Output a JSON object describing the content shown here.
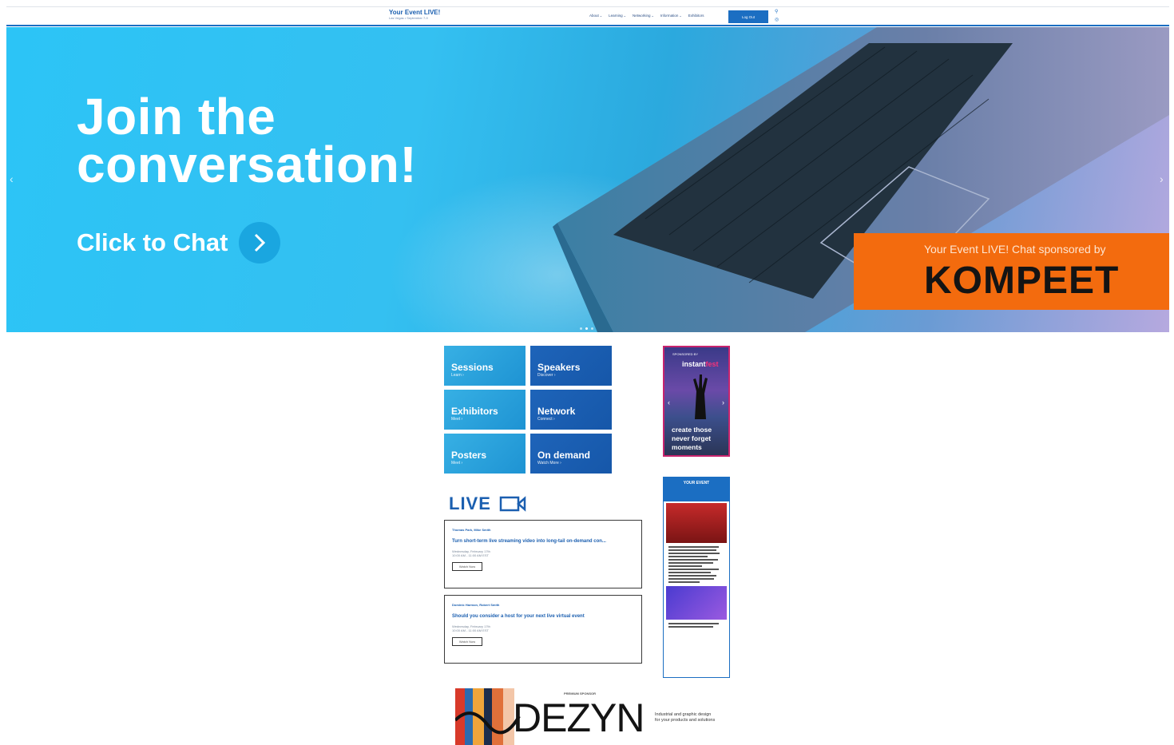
{
  "header": {
    "brand_title": "Your Event LIVE!",
    "brand_subtitle": "Las Vegas • September 7-9",
    "nav": [
      {
        "label": "About"
      },
      {
        "label": "Learning"
      },
      {
        "label": "Networking"
      },
      {
        "label": "Information"
      },
      {
        "label": "Exhibitors"
      }
    ],
    "login_label": "Log Out",
    "icons": [
      "search-icon",
      "globe-icon"
    ]
  },
  "hero": {
    "title": "Join the conversation!",
    "cta_label": "Click to Chat",
    "sponsor_line": "Your Event LIVE! Chat sponsored by",
    "sponsor_name": "KOMPEET",
    "slide_count": 3,
    "active_slide": 1,
    "colors": {
      "sky": "#2cc4f6",
      "sponsor_bg": "#f36b0e"
    }
  },
  "tiles": [
    {
      "title": "Sessions",
      "sub": "Learn ›"
    },
    {
      "title": "Speakers",
      "sub": "Discover ›"
    },
    {
      "title": "Exhibitors",
      "sub": "Meet ›"
    },
    {
      "title": "Network",
      "sub": "Connect ›"
    },
    {
      "title": "Posters",
      "sub": "Meet ›"
    },
    {
      "title": "On demand",
      "sub": "Watch More ›"
    }
  ],
  "live": {
    "label": "LIVE",
    "sessions": [
      {
        "speakers": "Thomas Park, Mike Smith",
        "title": "Turn short-term live streaming video into long-tail on-demand con...",
        "date": "Wednesday, February 17th",
        "time": "10:00 AM - 11:00 AM EST",
        "button": "Watch Now"
      },
      {
        "speakers": "Dominic Harmon, Robert Smith",
        "title": "Should you consider a host for your next live virtual event",
        "date": "Wednesday, February 17th",
        "time": "10:00 AM - 11:00 AM EST",
        "button": "Watch Now"
      }
    ]
  },
  "ads": {
    "top": {
      "small": "SPONSORED BY",
      "brand_a": "instant",
      "brand_b": "fest",
      "copy": "create those never forget moments"
    },
    "bottom": {
      "head": "YOUR EVENT"
    }
  },
  "premium": {
    "label": "PREMIUM SPONSOR",
    "name": "DEZYN",
    "tagline": "Industrial and graphic design for your products and solutions"
  }
}
